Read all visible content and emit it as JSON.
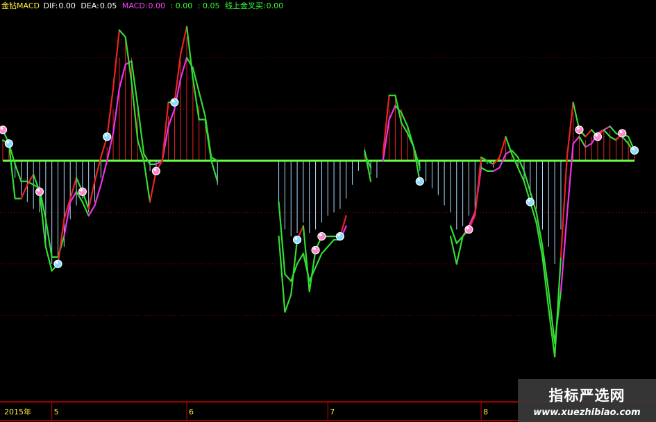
{
  "header": {
    "indicator_name": "金钻MACD",
    "dif_label": "DIF:",
    "dif_value": "0.00",
    "dea_label": "DEA:",
    "dea_value": "0.05",
    "macd_label": "MACD:",
    "macd_value": "0.00",
    "extra_value_1": ": 0.00",
    "extra_value_2": ": 0.05",
    "signal_label": "线上金叉买:",
    "signal_value": "0.00"
  },
  "colors": {
    "background": "#000000",
    "dif_line": "#33dd33",
    "dea_line": "#33dd33",
    "dif_up_segment": "#ee2222",
    "dea_up_segment": "#ee33ee",
    "zero_line": "#66ff44",
    "positive_bar": "#ee2222",
    "negative_bar": "#aaddff",
    "grid": "#990000",
    "axis": "#cc0000",
    "header_name": "#ffee33",
    "header_white": "#ffffff",
    "header_pink": "#ff44ff",
    "header_green": "#33ff33",
    "buy_marker": "#ff88cc",
    "sell_marker": "#88ddff"
  },
  "chart_data": {
    "type": "line",
    "x_tick_labels": [
      "2015年",
      "5",
      "6",
      "7",
      "8"
    ],
    "x_tick_index": [
      0,
      8,
      30,
      53,
      78
    ],
    "ylim": [
      -1.25,
      1.0
    ],
    "grid": true,
    "series": [
      {
        "key": "dif",
        "values": [
          0.18,
          0.1,
          -0.22,
          -0.22,
          -0.14,
          -0.08,
          -0.18,
          -0.5,
          -0.64,
          -0.6,
          -0.34,
          -0.22,
          -0.1,
          -0.18,
          -0.28,
          -0.12,
          0.02,
          0.14,
          0.42,
          0.76,
          0.72,
          0.46,
          0.12,
          0.0,
          -0.24,
          -0.06,
          0.0,
          0.34,
          0.34,
          0.62,
          0.78,
          0.48,
          0.24,
          0.24,
          0.0,
          -0.12,
          null,
          null,
          null,
          null,
          null,
          null,
          null,
          null,
          null,
          -0.44,
          -0.88,
          -0.78,
          -0.46,
          -0.38,
          -0.76,
          -0.52,
          -0.44,
          -0.44,
          -0.44,
          -0.44,
          -0.32,
          null,
          null,
          0.06,
          -0.12,
          null,
          0.04,
          0.38,
          0.38,
          0.22,
          0.16,
          0.08,
          -0.12,
          null,
          null,
          null,
          null,
          -0.44,
          -0.6,
          -0.44,
          -0.4,
          -0.32,
          0.02,
          0.0,
          -0.02,
          0.02,
          0.14,
          0.04,
          -0.04,
          -0.12,
          -0.24,
          -0.36,
          -0.56,
          -0.86,
          -1.14,
          -0.56,
          0.02,
          0.34,
          0.18,
          0.14,
          0.18,
          0.14,
          0.18,
          0.14,
          0.12,
          0.16,
          0.14,
          0.06
        ]
      },
      {
        "key": "dea",
        "values": [
          0.12,
          0.1,
          -0.02,
          -0.12,
          -0.12,
          -0.14,
          -0.16,
          -0.34,
          -0.56,
          -0.56,
          -0.44,
          -0.24,
          -0.18,
          -0.24,
          -0.32,
          -0.26,
          -0.14,
          0.0,
          0.16,
          0.42,
          0.56,
          0.58,
          0.32,
          0.04,
          -0.02,
          -0.02,
          0.0,
          0.2,
          0.3,
          0.48,
          0.6,
          0.54,
          0.4,
          0.26,
          0.02,
          0.0,
          null,
          null,
          null,
          null,
          null,
          null,
          null,
          null,
          null,
          -0.24,
          -0.66,
          -0.7,
          -0.6,
          -0.54,
          -0.7,
          -0.62,
          -0.54,
          -0.5,
          -0.46,
          -0.46,
          -0.38,
          null,
          null,
          0.04,
          -0.04,
          null,
          0.0,
          0.24,
          0.32,
          0.28,
          0.2,
          0.08,
          -0.04,
          null,
          null,
          null,
          null,
          -0.38,
          -0.48,
          -0.44,
          -0.38,
          -0.3,
          -0.04,
          -0.06,
          -0.06,
          -0.04,
          0.04,
          0.06,
          0.02,
          -0.06,
          -0.18,
          -0.3,
          -0.5,
          -0.76,
          -1.06,
          -0.76,
          -0.32,
          0.1,
          0.14,
          0.08,
          0.1,
          0.16,
          0.18,
          0.2,
          0.16,
          0.14,
          0.1,
          0.04
        ]
      },
      {
        "key": "macd",
        "values": [
          0.06,
          0.0,
          -0.2,
          -0.1,
          -0.02,
          0.06,
          -0.02,
          -0.16,
          -0.08,
          -0.04,
          0.1,
          0.02,
          0.08,
          0.06,
          0.04,
          0.14,
          0.16,
          0.14,
          0.26,
          0.34,
          0.16,
          -0.12,
          -0.2,
          -0.04,
          -0.22,
          -0.04,
          0.0,
          0.14,
          0.04,
          0.14,
          0.18,
          -0.06,
          -0.16,
          -0.02,
          -0.02,
          -0.12,
          null,
          null,
          null,
          null,
          null,
          null,
          null,
          null,
          null,
          -0.2,
          -0.22,
          -0.08,
          0.14,
          0.16,
          -0.06,
          0.1,
          0.1,
          0.06,
          0.02,
          0.02,
          0.06,
          null,
          null,
          0.02,
          -0.08,
          null,
          0.04,
          0.14,
          0.06,
          -0.06,
          -0.04,
          0.0,
          -0.08,
          null,
          null,
          null,
          null,
          -0.06,
          -0.12,
          0.0,
          -0.02,
          -0.02,
          0.06,
          0.06,
          0.04,
          0.06,
          0.1,
          -0.02,
          -0.06,
          -0.06,
          -0.06,
          -0.06,
          -0.06,
          -0.1,
          -0.08,
          0.2,
          0.34,
          0.24,
          0.04,
          0.06,
          0.08,
          -0.02,
          0.0,
          -0.06,
          -0.04,
          0.02,
          0.04,
          0.02
        ]
      }
    ],
    "bar_values": [
      0.12,
      0.06,
      -0.1,
      -0.2,
      -0.24,
      -0.28,
      -0.3,
      -0.5,
      -0.6,
      -0.56,
      -0.5,
      -0.34,
      -0.26,
      -0.22,
      -0.3,
      -0.24,
      -0.1,
      0.08,
      0.3,
      0.6,
      0.7,
      0.6,
      0.3,
      0.06,
      -0.06,
      -0.04,
      0.0,
      0.26,
      0.34,
      0.58,
      0.72,
      0.5,
      0.32,
      0.2,
      0.04,
      -0.14,
      null,
      null,
      null,
      null,
      null,
      null,
      null,
      null,
      null,
      -0.24,
      -0.4,
      -0.44,
      -0.42,
      -0.36,
      -0.42,
      -0.4,
      -0.36,
      -0.32,
      -0.3,
      -0.28,
      -0.22,
      -0.14,
      -0.06,
      0.08,
      -0.08,
      -0.1,
      0.06,
      0.3,
      0.36,
      0.3,
      0.2,
      0.08,
      -0.06,
      -0.12,
      -0.16,
      -0.2,
      -0.26,
      -0.3,
      -0.4,
      -0.38,
      -0.32,
      -0.28,
      -0.06,
      -0.02,
      -0.04,
      0.02,
      0.12,
      0.04,
      -0.04,
      -0.12,
      -0.2,
      -0.28,
      -0.4,
      -0.5,
      -0.6,
      -0.4,
      0.06,
      0.28,
      0.16,
      0.12,
      0.14,
      0.16,
      0.18,
      0.18,
      0.14,
      0.16,
      0.12,
      0.04
    ],
    "buy_marker_index": [
      0,
      6,
      13,
      25,
      94,
      101,
      44,
      51,
      76,
      97,
      52
    ],
    "sell_marker_index": [
      1,
      9,
      17,
      28,
      41,
      58,
      68,
      48,
      55,
      86,
      103
    ]
  }
}
